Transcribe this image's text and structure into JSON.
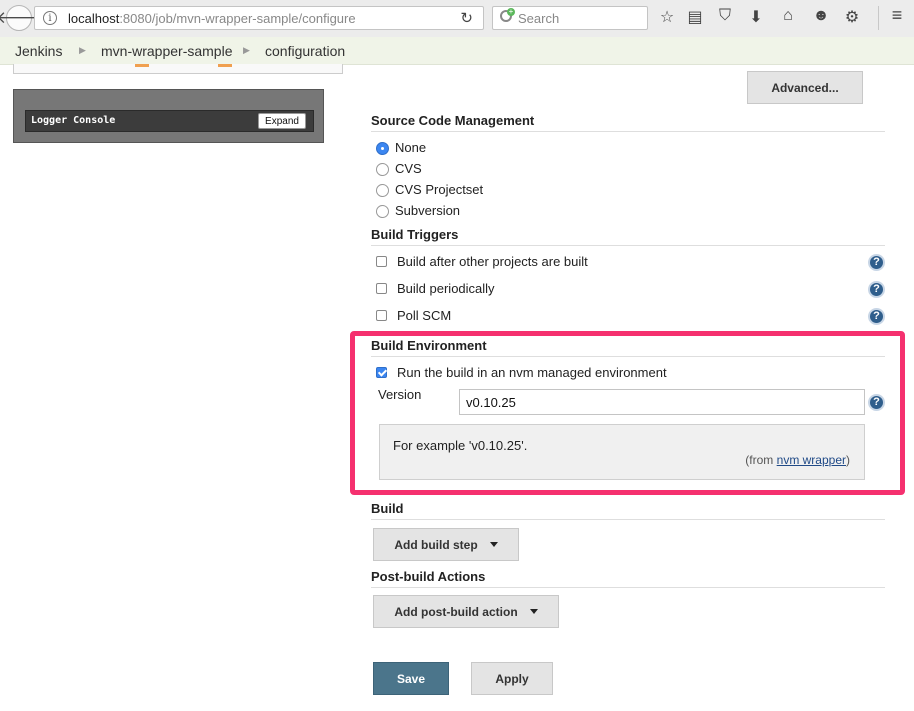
{
  "browser": {
    "url_host": "localhost",
    "url_rest": ":8080/job/mvn-wrapper-sample/configure",
    "search_placeholder": "Search",
    "back_glyph": "🡐",
    "info_glyph": "i",
    "reload_glyph": "↻",
    "toolbar_icons": [
      "star-icon",
      "reading-list-icon",
      "pocket-icon",
      "download-icon",
      "home-icon",
      "chat-icon",
      "extension-icon",
      "menu-icon"
    ]
  },
  "breadcrumb": {
    "items": [
      "Jenkins",
      "mvn-wrapper-sample",
      "configuration"
    ]
  },
  "logger": {
    "title": "Logger Console",
    "expand_label": "Expand"
  },
  "advanced_label": "Advanced...",
  "scm": {
    "title": "Source Code Management",
    "options": [
      "None",
      "CVS",
      "CVS Projectset",
      "Subversion"
    ],
    "selected": "None"
  },
  "triggers": {
    "title": "Build Triggers",
    "options": [
      "Build after other projects are built",
      "Build periodically",
      "Poll SCM"
    ]
  },
  "build_env": {
    "title": "Build Environment",
    "nvm_label": "Run the build in an nvm managed environment",
    "nvm_checked": true,
    "version_label": "Version",
    "version_value": "v0.10.25",
    "help_text": "For example 'v0.10.25'.",
    "help_from_prefix": "(from ",
    "help_from_link": "nvm wrapper",
    "help_from_suffix": ")",
    "highlight_color": "#f5306f"
  },
  "build": {
    "title": "Build",
    "add_step_label": "Add build step"
  },
  "post_build": {
    "title": "Post-build Actions",
    "add_action_label": "Add post-build action"
  },
  "actions": {
    "save_label": "Save",
    "apply_label": "Apply"
  },
  "help_glyph": "?",
  "colors": {
    "save_button": "#4b758b",
    "radio_selected": "#3b86f1",
    "help_icon": "#2f5e8c"
  }
}
